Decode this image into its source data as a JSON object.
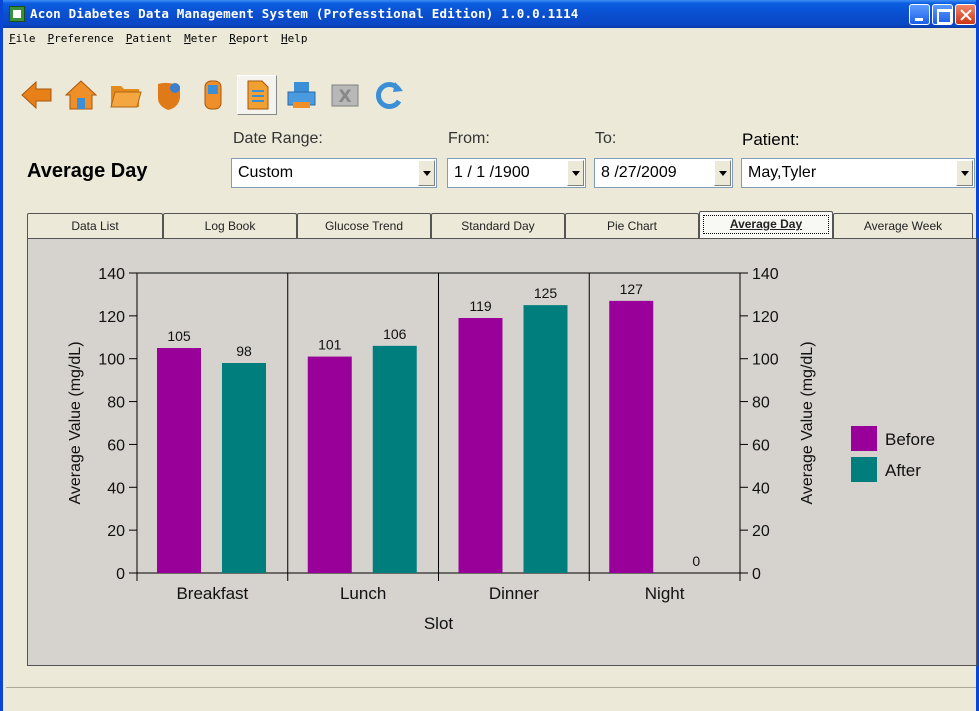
{
  "window": {
    "title": "Acon Diabetes Data Management System (Professtional Edition) 1.0.0.1114"
  },
  "menu": [
    "File",
    "Preference",
    "Patient",
    "Meter",
    "Report",
    "Help"
  ],
  "toolbar": {
    "icons": [
      "back-arrow-icon",
      "home-icon",
      "open-folder-icon",
      "hands-icon",
      "meter-device-icon",
      "report-document-icon",
      "print-icon",
      "export-excel-icon",
      "refresh-icon"
    ],
    "active": "report-document-icon"
  },
  "header": {
    "page_title": "Average Day",
    "date_range_label": "Date Range:",
    "date_range_value": "Custom",
    "from_label": "From:",
    "from_value": "1 / 1 /1900",
    "to_label": "To:",
    "to_value": "8 /27/2009",
    "patient_label": "Patient:",
    "patient_value": "May,Tyler"
  },
  "tabs": [
    "Data List",
    "Log Book",
    "Glucose Trend",
    "Standard Day",
    "Pie Chart",
    "Average Day",
    "Average Week"
  ],
  "selected_tab": "Average Day",
  "chart_data": {
    "type": "bar",
    "categories": [
      "Breakfast",
      "Lunch",
      "Dinner",
      "Night"
    ],
    "series": [
      {
        "name": "Before",
        "values": [
          105,
          101,
          119,
          127
        ],
        "color": "#990099"
      },
      {
        "name": "After",
        "values": [
          98,
          106,
          125,
          0
        ],
        "color": "#007d7d"
      }
    ],
    "xlabel": "Slot",
    "ylabel": "Average Value (mg/dL)",
    "ylim": [
      0,
      140
    ],
    "yticks": [
      0,
      20,
      40,
      60,
      80,
      100,
      120,
      140
    ],
    "legend_position": "right",
    "grid": false
  }
}
